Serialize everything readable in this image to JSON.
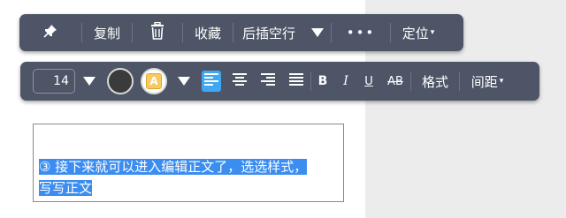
{
  "toolbar_top": {
    "pin_icon": "pin-icon",
    "copy_label": "复制",
    "delete_icon": "trash-icon",
    "favorite_label": "收藏",
    "insert_blank_label": "后插空行",
    "more_icon": "more-dots-icon",
    "more_label": "•••",
    "locate_label": "定位",
    "locate_caret": "▾"
  },
  "toolbar_format": {
    "font_size": "14",
    "text_color": "#3b3b3b",
    "highlight_letter": "A",
    "bold_label": "B",
    "italic_label": "I",
    "underline_label": "U",
    "strike_label": "AB",
    "format_label": "格式",
    "spacing_label": "间距",
    "spacing_caret": "▾",
    "active_alignment": "align-left",
    "accent_color": "#3fa8f4"
  },
  "editor": {
    "line1": "③ 接下来就可以进入编辑正文了，选选样式，",
    "line2": "写写正文",
    "selection_color": "#3b8df0"
  }
}
